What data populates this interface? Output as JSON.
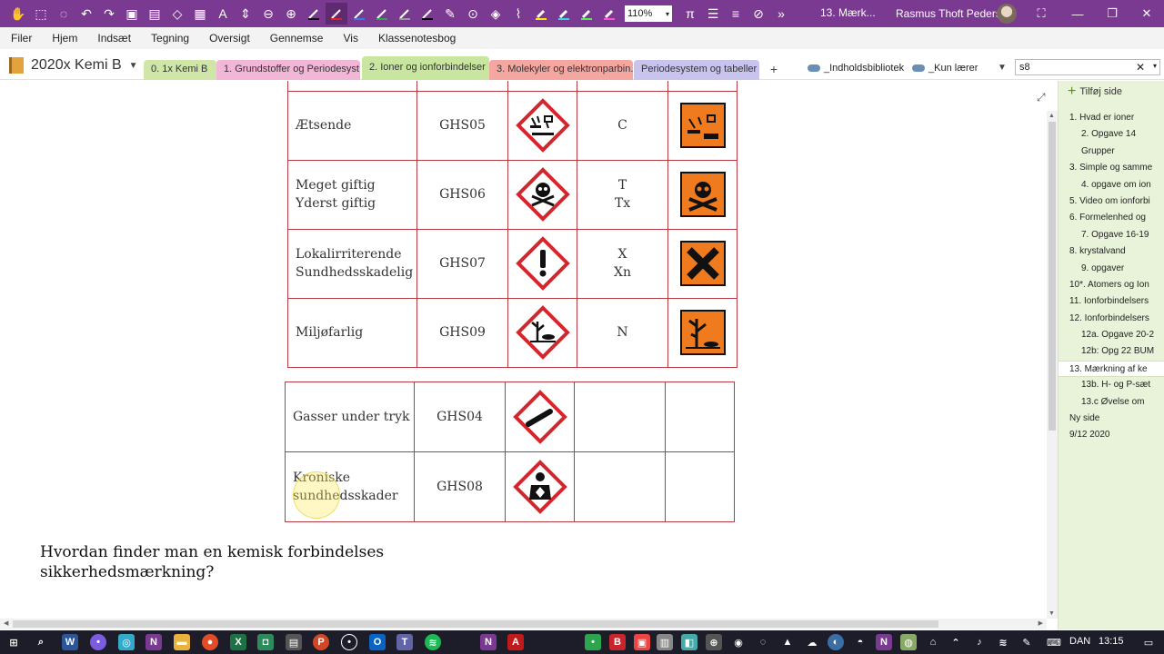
{
  "titlebar": {
    "zoom": "110%",
    "page_title": "13. Mærk...",
    "user_name": "Rasmus Thoft Pedersen"
  },
  "menu": [
    "Filer",
    "Hjem",
    "Indsæt",
    "Tegning",
    "Oversigt",
    "Gennemse",
    "Vis",
    "Klassenotesbog"
  ],
  "notebook": {
    "name": "2020x Kemi B"
  },
  "sections": [
    {
      "label": "0. 1x Kemi B",
      "color": "#cfe6a8"
    },
    {
      "label": "1. Grundstoffer og Periodesyst...",
      "color": "#f2b6d6"
    },
    {
      "label": "2. Ioner og ionforbindelser",
      "color": "#c9e6a1"
    },
    {
      "label": "3. Molekyler og elektronparbin...",
      "color": "#f4a6a0"
    },
    {
      "label": "Periodesystem og tabeller",
      "color": "#c9c4ee"
    }
  ],
  "libraries": [
    "_Indholdsbibliotek",
    "_Kun lærer"
  ],
  "search": {
    "value": "s8"
  },
  "table_top": [
    {
      "name": [
        "Ætsende"
      ],
      "code": "GHS05",
      "old": [
        "C"
      ],
      "pictogram": "corrosive-icon",
      "orange": "corrosive-orange-icon"
    },
    {
      "name": [
        "Meget giftig",
        "Yderst giftig"
      ],
      "code": "GHS06",
      "old": [
        "T",
        "Tx"
      ],
      "pictogram": "skull-icon",
      "orange": "skull-orange-icon"
    },
    {
      "name": [
        "Lokalirriterende",
        "Sundhedsskadelig"
      ],
      "code": "GHS07",
      "old": [
        "X",
        "Xn"
      ],
      "pictogram": "exclamation-icon",
      "orange": "cross-orange-icon"
    },
    {
      "name": [
        "Miljøfarlig"
      ],
      "code": "GHS09",
      "old": [
        "N"
      ],
      "pictogram": "environment-icon",
      "orange": "dead-tree-orange-icon"
    }
  ],
  "table_bottom": [
    {
      "name": [
        "Gasser under tryk"
      ],
      "code": "GHS04",
      "pictogram": "gas-cylinder-icon"
    },
    {
      "name": [
        "Kroniske",
        "sundhedsskader"
      ],
      "code": "GHS08",
      "pictogram": "health-hazard-icon"
    }
  ],
  "question": [
    "Hvordan finder man en kemisk forbindelses",
    "sikkerhedsmærkning?"
  ],
  "pages": {
    "add_label": "Tilføj side",
    "items": [
      {
        "label": "1. Hvad er ioner",
        "level": 1
      },
      {
        "label": "2. Opgave 14",
        "level": 2
      },
      {
        "label": "Grupper",
        "level": 2
      },
      {
        "label": "3. Simple og samme",
        "level": 1
      },
      {
        "label": "4. opgave om ion",
        "level": 2
      },
      {
        "label": "5. Video om ionforbi",
        "level": 1
      },
      {
        "label": "6. Formelenhed og",
        "level": 1
      },
      {
        "label": "7. Opgave 16-19",
        "level": 2
      },
      {
        "label": "8.  krystalvand",
        "level": 1
      },
      {
        "label": "9. opgaver",
        "level": 2
      },
      {
        "label": "10*. Atomers og Ion",
        "level": 1
      },
      {
        "label": "11. Ionforbindelsers",
        "level": 1
      },
      {
        "label": "12. Ionforbindelsers",
        "level": 1
      },
      {
        "label": "12a. Opgave 20-2",
        "level": 2
      },
      {
        "label": "12b: Opg 22 BUM",
        "level": 2
      },
      {
        "label": "13. Mærkning af ke",
        "level": 1,
        "selected": true
      },
      {
        "label": "13b. H- og P-sæt",
        "level": 2
      },
      {
        "label": "13.c Øvelse om",
        "level": 2
      },
      {
        "label": "Ny side",
        "level": 1
      },
      {
        "label": "9/12 2020",
        "level": 1
      }
    ]
  },
  "taskbar": {
    "language": "DAN",
    "time": "13:15"
  }
}
